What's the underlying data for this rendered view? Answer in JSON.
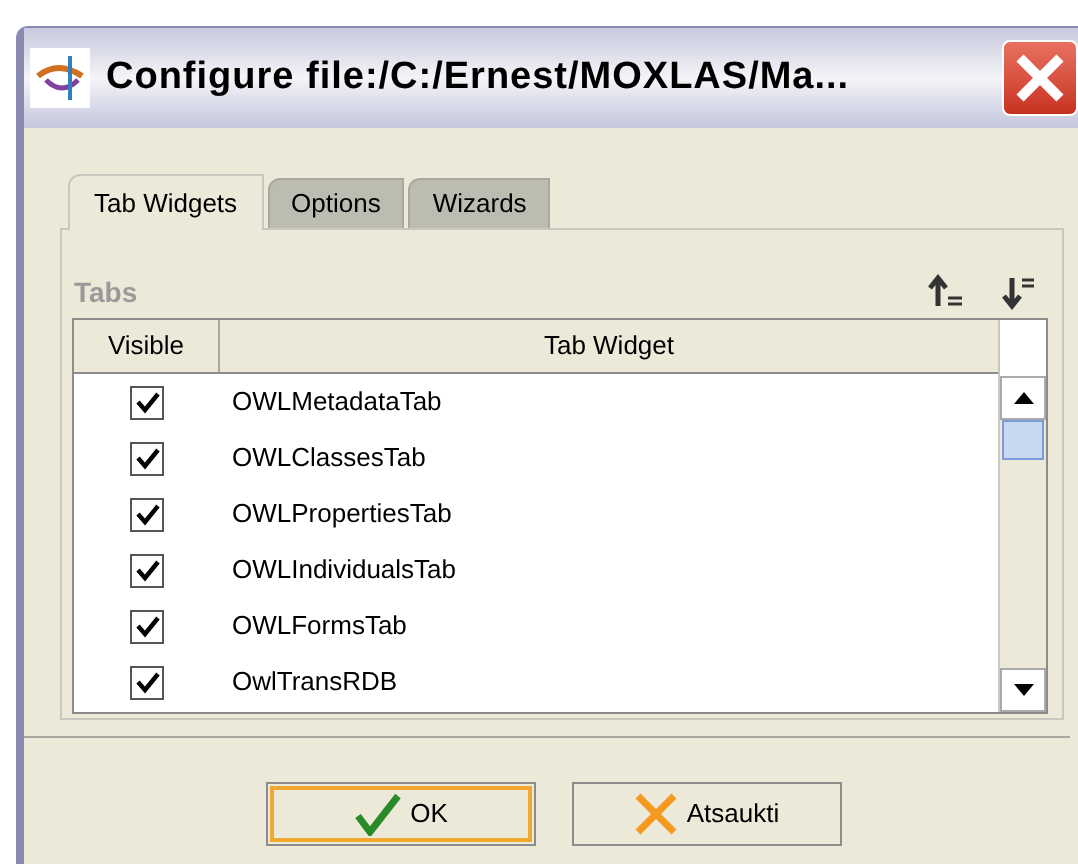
{
  "window": {
    "title": "Configure file:/C:/Ernest/MOXLAS/Ma..."
  },
  "tabs": [
    {
      "label": "Tab Widgets",
      "selected": true
    },
    {
      "label": "Options",
      "selected": false
    },
    {
      "label": "Wizards",
      "selected": false
    }
  ],
  "section": {
    "title": "Tabs"
  },
  "table": {
    "columns": [
      "Visible",
      "Tab Widget"
    ],
    "rows": [
      {
        "visible": true,
        "name": "OWLMetadataTab"
      },
      {
        "visible": true,
        "name": "OWLClassesTab"
      },
      {
        "visible": true,
        "name": "OWLPropertiesTab"
      },
      {
        "visible": true,
        "name": "OWLIndividualsTab"
      },
      {
        "visible": true,
        "name": "OWLFormsTab"
      },
      {
        "visible": true,
        "name": "OwlTransRDB"
      }
    ]
  },
  "buttons": [
    {
      "kind": "ok",
      "label": "OK"
    },
    {
      "kind": "cancel",
      "label": "Atsaukti"
    }
  ]
}
